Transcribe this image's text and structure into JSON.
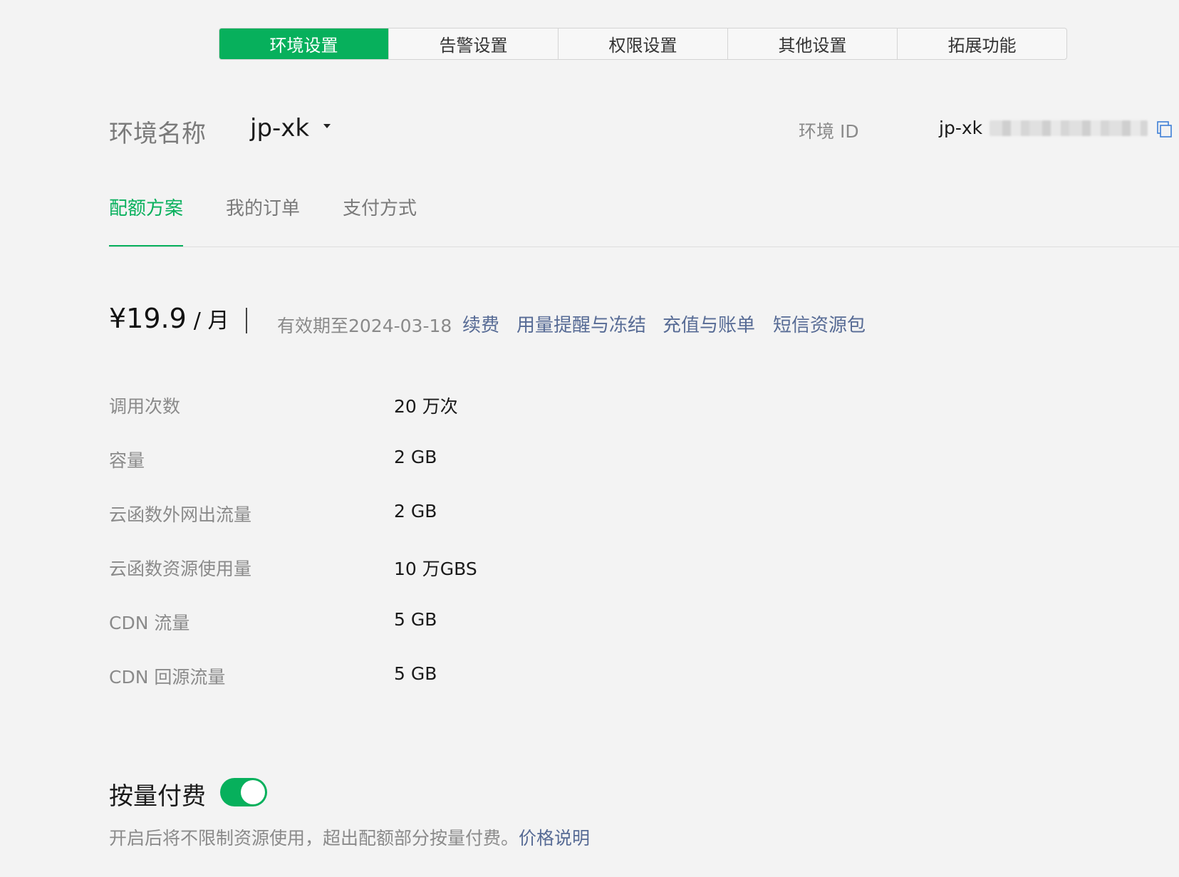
{
  "top_tabs": [
    {
      "label": "环境设置",
      "active": true
    },
    {
      "label": "告警设置",
      "active": false
    },
    {
      "label": "权限设置",
      "active": false
    },
    {
      "label": "其他设置",
      "active": false
    },
    {
      "label": "拓展功能",
      "active": false
    }
  ],
  "env": {
    "name_label": "环境名称",
    "name_value": "jp-xk",
    "id_label": "环境 ID",
    "id_value_prefix": "jp-xk"
  },
  "sub_tabs": [
    {
      "label": "配额方案",
      "active": true
    },
    {
      "label": "我的订单",
      "active": false
    },
    {
      "label": "支付方式",
      "active": false
    }
  ],
  "plan": {
    "price": "¥19.9",
    "price_unit": "/ 月",
    "validity": "有效期至2024-03-18",
    "links": [
      "续费",
      "用量提醒与冻结",
      "充值与账单",
      "短信资源包"
    ]
  },
  "quotas": [
    {
      "label": "调用次数",
      "value": "20 万次"
    },
    {
      "label": "容量",
      "value": "2 GB"
    },
    {
      "label": "云函数外网出流量",
      "value": "2 GB"
    },
    {
      "label": "云函数资源使用量",
      "value": "10 万GBS"
    },
    {
      "label": "CDN 流量",
      "value": "5 GB"
    },
    {
      "label": "CDN 回源流量",
      "value": "5 GB"
    }
  ],
  "payg": {
    "title": "按量付费",
    "enabled": true,
    "description": "开启后将不限制资源使用，超出配额部分按量付费。",
    "link": "价格说明"
  },
  "colors": {
    "accent": "#07b05c",
    "link": "#576b95",
    "background": "#f3f3f3"
  },
  "icons": {
    "dropdown": "caret-down-icon",
    "copy": "copy-icon"
  }
}
